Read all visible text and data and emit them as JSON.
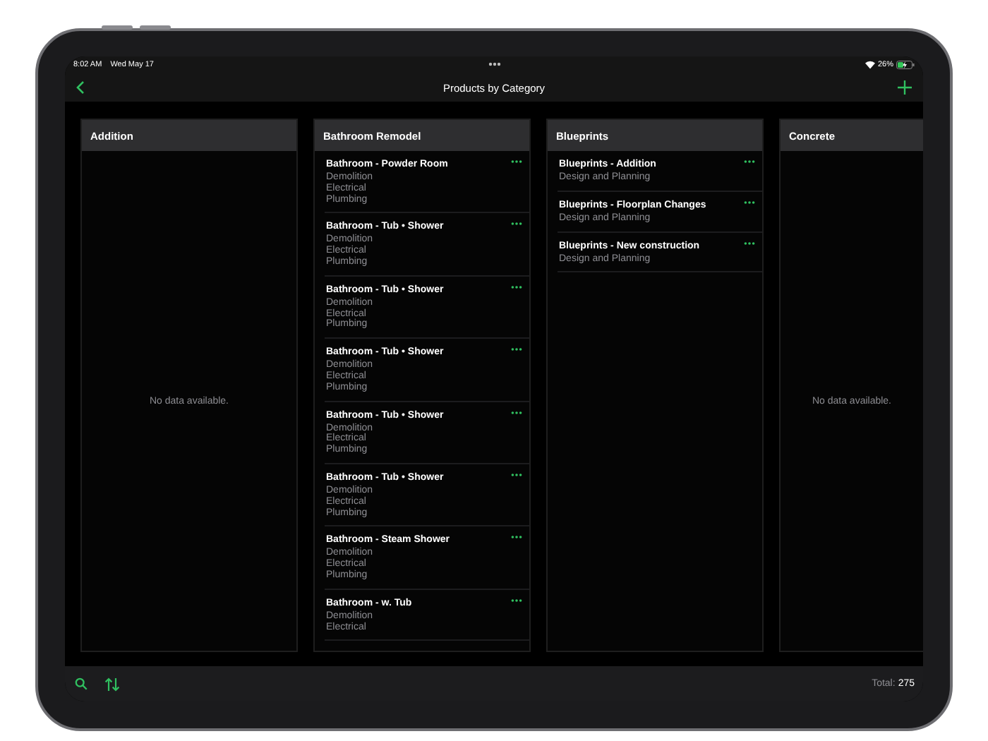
{
  "status_bar": {
    "time": "8:02 AM",
    "date": "Wed May 17",
    "battery": "26%"
  },
  "nav_bar": {
    "title": "Products by Category"
  },
  "columns": [
    {
      "title": "Addition",
      "empty_text": "No data available."
    },
    {
      "title": "Bathroom Remodel",
      "items": [
        {
          "title": "Bathroom - Powder Room",
          "lines": [
            "Demolition",
            "Electrical",
            "Plumbing"
          ]
        },
        {
          "title": "Bathroom - Tub • Shower",
          "lines": [
            "Demolition",
            "Electrical",
            "Plumbing"
          ]
        },
        {
          "title": "Bathroom - Tub • Shower",
          "lines": [
            "Demolition",
            "Electrical",
            "Plumbing"
          ]
        },
        {
          "title": "Bathroom - Tub • Shower",
          "lines": [
            "Demolition",
            "Electrical",
            "Plumbing"
          ]
        },
        {
          "title": "Bathroom - Tub • Shower",
          "lines": [
            "Demolition",
            "Electrical",
            "Plumbing"
          ]
        },
        {
          "title": "Bathroom - Tub • Shower",
          "lines": [
            "Demolition",
            "Electrical",
            "Plumbing"
          ]
        },
        {
          "title": "Bathroom - Steam Shower",
          "lines": [
            "Demolition",
            "Electrical",
            "Plumbing"
          ]
        },
        {
          "title": "Bathroom - w. Tub",
          "lines": [
            "Demolition",
            "Electrical"
          ]
        }
      ]
    },
    {
      "title": "Blueprints",
      "items": [
        {
          "title": "Blueprints - Addition",
          "lines": [
            "Design and Planning"
          ]
        },
        {
          "title": "Blueprints - Floorplan Changes",
          "lines": [
            "Design and Planning"
          ]
        },
        {
          "title": "Blueprints - New construction",
          "lines": [
            "Design and Planning"
          ]
        }
      ]
    },
    {
      "title": "Concrete",
      "empty_text": "No data available."
    }
  ],
  "toolbar": {
    "total_label": "Total:",
    "total": "275"
  }
}
